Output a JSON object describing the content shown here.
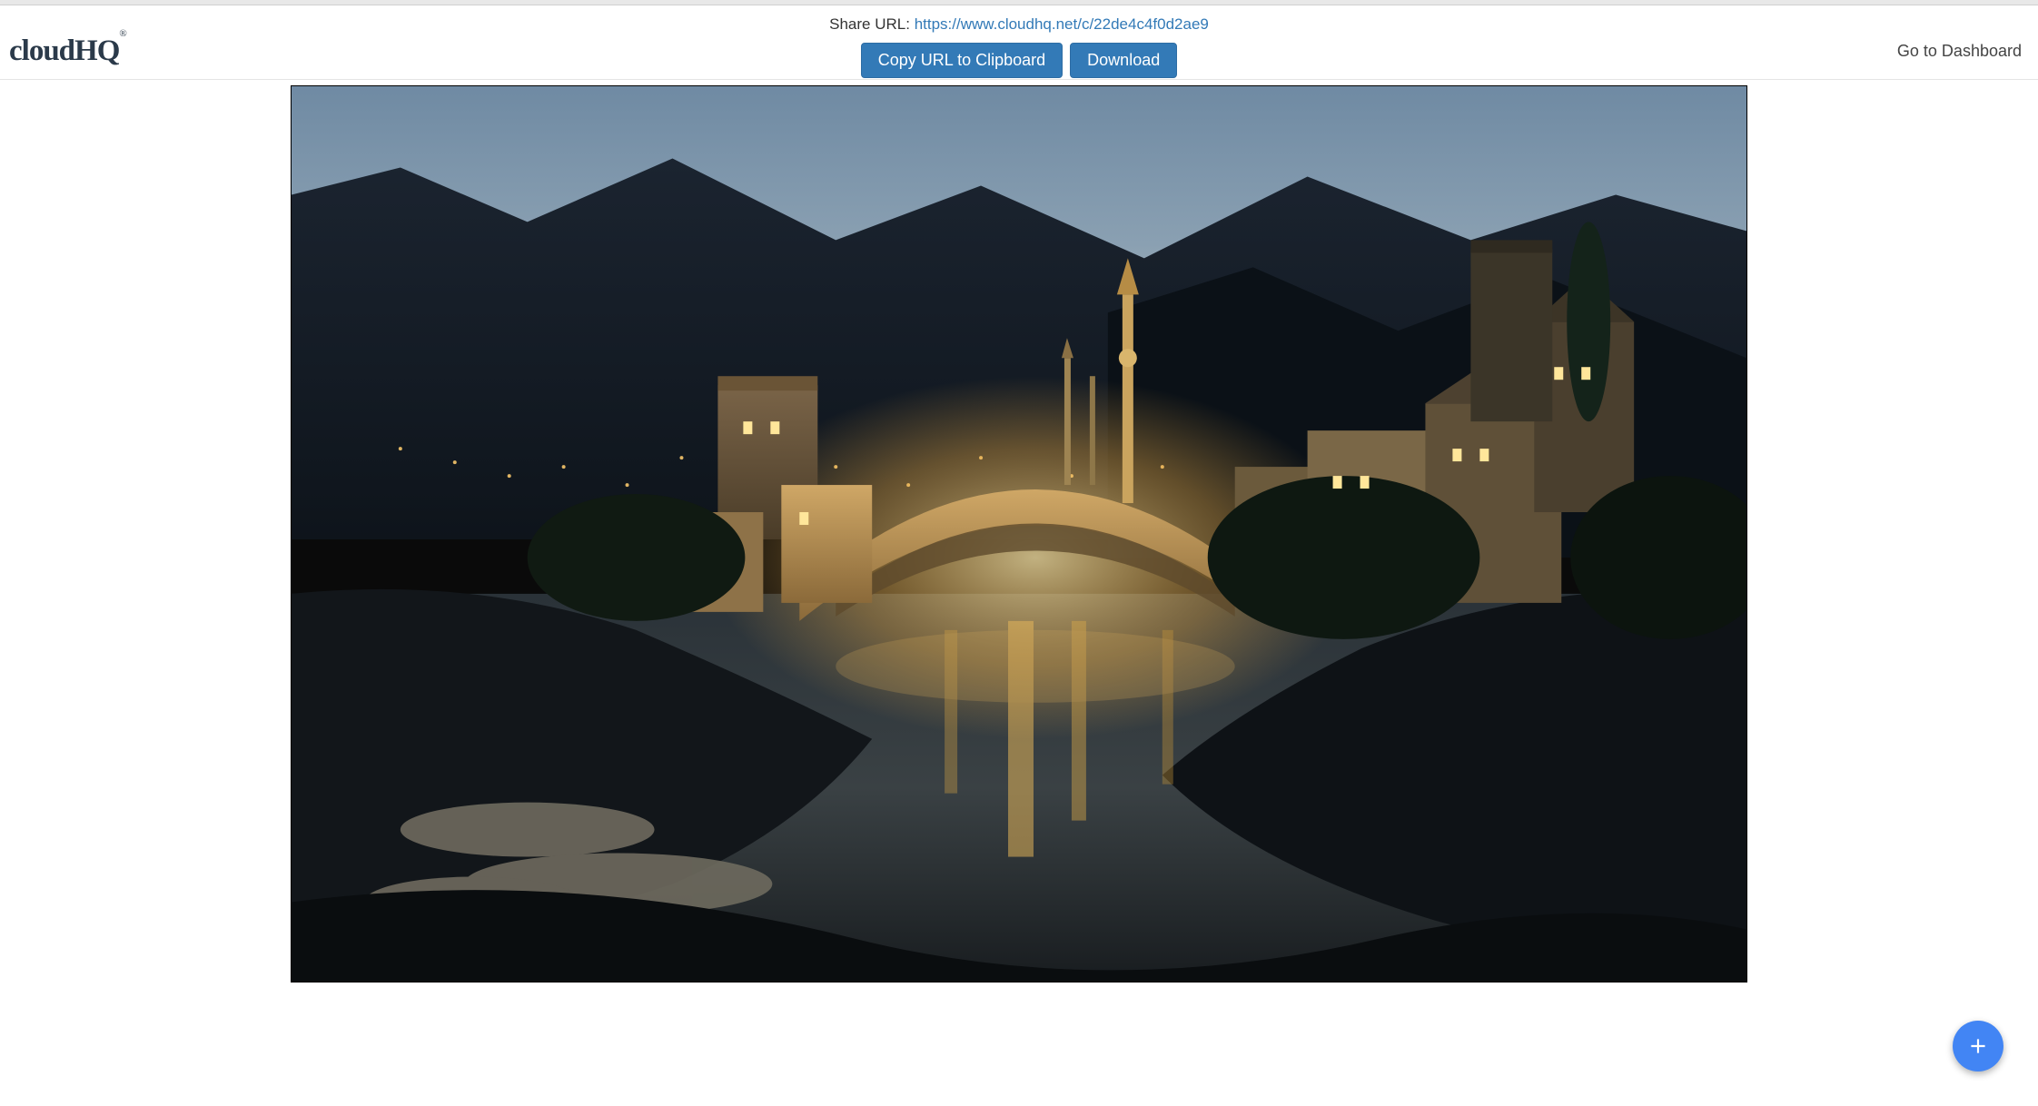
{
  "logo": {
    "text": "cloudHQ",
    "sup": "®"
  },
  "share": {
    "label": "Share URL: ",
    "url": "https://www.cloudhq.net/c/22de4c4f0d2ae9"
  },
  "buttons": {
    "copy": "Copy URL to Clipboard",
    "download": "Download"
  },
  "nav": {
    "dashboard": "Go to Dashboard"
  },
  "fab": {
    "icon": "plus-icon"
  },
  "image": {
    "alt": "Night photograph of an arched stone bridge over a river with illuminated historic buildings, towers, and a minaret; dark mountains and dusk sky in the background."
  }
}
